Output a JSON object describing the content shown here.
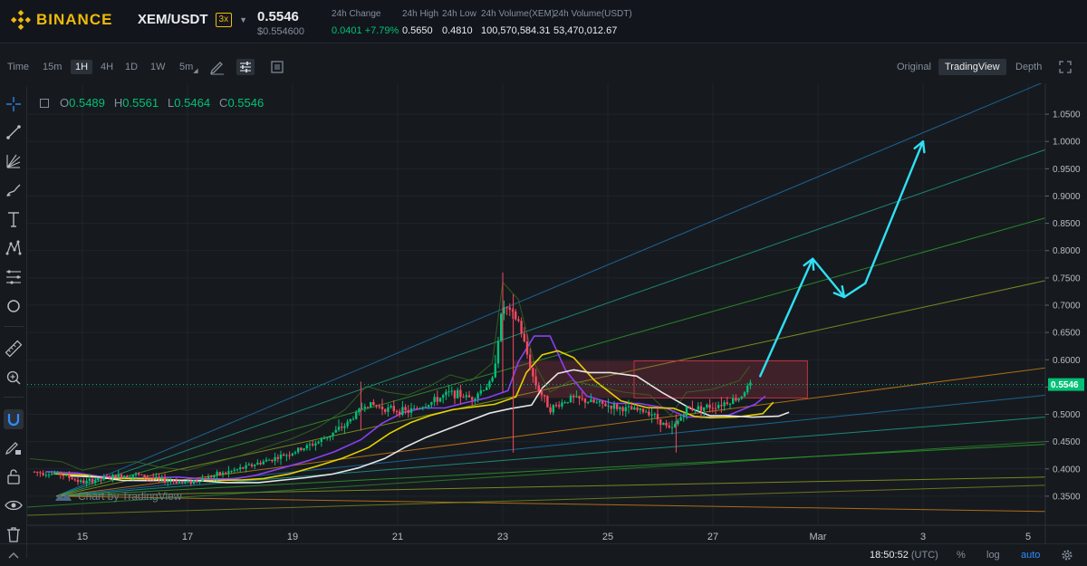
{
  "header": {
    "brand": "BINANCE",
    "pair": "XEM/USDT",
    "leverage": "3x",
    "last_price": "0.5546",
    "usd_price": "$0.554600",
    "stats": [
      {
        "label": "24h Change",
        "value": "0.0401 +7.79%",
        "positive": true
      },
      {
        "label": "24h High",
        "value": "0.5650"
      },
      {
        "label": "24h Low",
        "value": "0.4810"
      },
      {
        "label": "24h Volume(XEM)",
        "value": "100,570,584.31"
      },
      {
        "label": "24h Volume(USDT)",
        "value": "53,470,012.67"
      }
    ]
  },
  "toolbar": {
    "time_label": "Time",
    "intervals": [
      "15m",
      "1H",
      "4H",
      "1D",
      "1W",
      "5m"
    ],
    "active_interval": "1H",
    "views": [
      "Original",
      "TradingView",
      "Depth"
    ],
    "active_view": "TradingView"
  },
  "ohlc": {
    "o_label": "O",
    "o": "0.5489",
    "h_label": "H",
    "h": "0.5561",
    "l_label": "L",
    "l": "0.5464",
    "c_label": "C",
    "c": "0.5546"
  },
  "watermark": "Chart by TradingView",
  "chart_data": {
    "type": "candlestick",
    "x_tick_labels": [
      "15",
      "17",
      "19",
      "21",
      "23",
      "25",
      "27",
      "Mar",
      "3",
      "5"
    ],
    "y_tick_labels": [
      "1.0500",
      "1.0000",
      "0.9500",
      "0.9000",
      "0.8500",
      "0.8000",
      "0.7500",
      "0.7000",
      "0.6500",
      "0.6000",
      "0.5500",
      "0.5000",
      "0.4500",
      "0.4000",
      "0.3500"
    ],
    "current_price_label": "0.5546",
    "ylim": [
      0.31,
      1.09
    ],
    "grid": true,
    "colors": {
      "up": "#02c076",
      "down": "#f84960",
      "projection": "#2fe0f5",
      "current_price": "#02c076"
    },
    "price_path": [
      {
        "day": 14.0,
        "price": 0.395
      },
      {
        "day": 14.6,
        "price": 0.39
      },
      {
        "day": 15.0,
        "price": 0.375
      },
      {
        "day": 15.5,
        "price": 0.385
      },
      {
        "day": 16.0,
        "price": 0.39
      },
      {
        "day": 16.5,
        "price": 0.38
      },
      {
        "day": 17.0,
        "price": 0.375
      },
      {
        "day": 17.6,
        "price": 0.39
      },
      {
        "day": 18.0,
        "price": 0.4
      },
      {
        "day": 18.5,
        "price": 0.415
      },
      {
        "day": 19.0,
        "price": 0.43
      },
      {
        "day": 19.5,
        "price": 0.45
      },
      {
        "day": 20.0,
        "price": 0.48
      },
      {
        "day": 20.4,
        "price": 0.52
      },
      {
        "day": 20.8,
        "price": 0.51
      },
      {
        "day": 21.2,
        "price": 0.505
      },
      {
        "day": 21.6,
        "price": 0.52
      },
      {
        "day": 22.0,
        "price": 0.54
      },
      {
        "day": 22.4,
        "price": 0.53
      },
      {
        "day": 22.8,
        "price": 0.56
      },
      {
        "day": 23.0,
        "price": 0.7
      },
      {
        "day": 23.3,
        "price": 0.67
      },
      {
        "day": 23.6,
        "price": 0.56
      },
      {
        "day": 23.9,
        "price": 0.51
      },
      {
        "day": 24.3,
        "price": 0.53
      },
      {
        "day": 24.8,
        "price": 0.52
      },
      {
        "day": 25.3,
        "price": 0.51
      },
      {
        "day": 25.8,
        "price": 0.505
      },
      {
        "day": 26.2,
        "price": 0.47
      },
      {
        "day": 26.5,
        "price": 0.51
      },
      {
        "day": 27.0,
        "price": 0.515
      },
      {
        "day": 27.5,
        "price": 0.53
      },
      {
        "day": 27.7,
        "price": 0.5546
      }
    ],
    "projection_path": [
      {
        "day": 27.9,
        "price": 0.57
      },
      {
        "day": 28.9,
        "price": 0.785
      },
      {
        "day": 29.5,
        "price": 0.715
      },
      {
        "day": 29.9,
        "price": 0.74
      },
      {
        "day": 31.0,
        "price": 1.0
      }
    ]
  },
  "footer": {
    "time": "18:50:52",
    "tz": "(UTC)",
    "percent": "%",
    "log": "log",
    "auto": "auto"
  }
}
